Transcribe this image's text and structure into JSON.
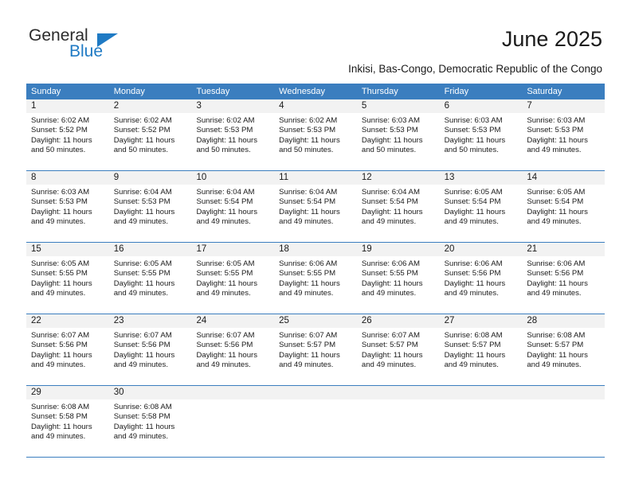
{
  "brand": {
    "name_part1": "General",
    "name_part2": "Blue",
    "logo_icon": "triangle-icon"
  },
  "header": {
    "title": "June 2025",
    "subtitle": "Inkisi, Bas-Congo, Democratic Republic of the Congo"
  },
  "colors": {
    "header_blue": "#3b7ebf",
    "brand_blue": "#1f7ac4",
    "daynum_band": "#f2f2f2",
    "text": "#1a1a1a"
  },
  "calendar": {
    "weekday_headers": [
      "Sunday",
      "Monday",
      "Tuesday",
      "Wednesday",
      "Thursday",
      "Friday",
      "Saturday"
    ],
    "weeks": [
      [
        {
          "day": "1",
          "sunrise": "Sunrise: 6:02 AM",
          "sunset": "Sunset: 5:52 PM",
          "daylight": "Daylight: 11 hours and 50 minutes."
        },
        {
          "day": "2",
          "sunrise": "Sunrise: 6:02 AM",
          "sunset": "Sunset: 5:52 PM",
          "daylight": "Daylight: 11 hours and 50 minutes."
        },
        {
          "day": "3",
          "sunrise": "Sunrise: 6:02 AM",
          "sunset": "Sunset: 5:53 PM",
          "daylight": "Daylight: 11 hours and 50 minutes."
        },
        {
          "day": "4",
          "sunrise": "Sunrise: 6:02 AM",
          "sunset": "Sunset: 5:53 PM",
          "daylight": "Daylight: 11 hours and 50 minutes."
        },
        {
          "day": "5",
          "sunrise": "Sunrise: 6:03 AM",
          "sunset": "Sunset: 5:53 PM",
          "daylight": "Daylight: 11 hours and 50 minutes."
        },
        {
          "day": "6",
          "sunrise": "Sunrise: 6:03 AM",
          "sunset": "Sunset: 5:53 PM",
          "daylight": "Daylight: 11 hours and 50 minutes."
        },
        {
          "day": "7",
          "sunrise": "Sunrise: 6:03 AM",
          "sunset": "Sunset: 5:53 PM",
          "daylight": "Daylight: 11 hours and 49 minutes."
        }
      ],
      [
        {
          "day": "8",
          "sunrise": "Sunrise: 6:03 AM",
          "sunset": "Sunset: 5:53 PM",
          "daylight": "Daylight: 11 hours and 49 minutes."
        },
        {
          "day": "9",
          "sunrise": "Sunrise: 6:04 AM",
          "sunset": "Sunset: 5:53 PM",
          "daylight": "Daylight: 11 hours and 49 minutes."
        },
        {
          "day": "10",
          "sunrise": "Sunrise: 6:04 AM",
          "sunset": "Sunset: 5:54 PM",
          "daylight": "Daylight: 11 hours and 49 minutes."
        },
        {
          "day": "11",
          "sunrise": "Sunrise: 6:04 AM",
          "sunset": "Sunset: 5:54 PM",
          "daylight": "Daylight: 11 hours and 49 minutes."
        },
        {
          "day": "12",
          "sunrise": "Sunrise: 6:04 AM",
          "sunset": "Sunset: 5:54 PM",
          "daylight": "Daylight: 11 hours and 49 minutes."
        },
        {
          "day": "13",
          "sunrise": "Sunrise: 6:05 AM",
          "sunset": "Sunset: 5:54 PM",
          "daylight": "Daylight: 11 hours and 49 minutes."
        },
        {
          "day": "14",
          "sunrise": "Sunrise: 6:05 AM",
          "sunset": "Sunset: 5:54 PM",
          "daylight": "Daylight: 11 hours and 49 minutes."
        }
      ],
      [
        {
          "day": "15",
          "sunrise": "Sunrise: 6:05 AM",
          "sunset": "Sunset: 5:55 PM",
          "daylight": "Daylight: 11 hours and 49 minutes."
        },
        {
          "day": "16",
          "sunrise": "Sunrise: 6:05 AM",
          "sunset": "Sunset: 5:55 PM",
          "daylight": "Daylight: 11 hours and 49 minutes."
        },
        {
          "day": "17",
          "sunrise": "Sunrise: 6:05 AM",
          "sunset": "Sunset: 5:55 PM",
          "daylight": "Daylight: 11 hours and 49 minutes."
        },
        {
          "day": "18",
          "sunrise": "Sunrise: 6:06 AM",
          "sunset": "Sunset: 5:55 PM",
          "daylight": "Daylight: 11 hours and 49 minutes."
        },
        {
          "day": "19",
          "sunrise": "Sunrise: 6:06 AM",
          "sunset": "Sunset: 5:55 PM",
          "daylight": "Daylight: 11 hours and 49 minutes."
        },
        {
          "day": "20",
          "sunrise": "Sunrise: 6:06 AM",
          "sunset": "Sunset: 5:56 PM",
          "daylight": "Daylight: 11 hours and 49 minutes."
        },
        {
          "day": "21",
          "sunrise": "Sunrise: 6:06 AM",
          "sunset": "Sunset: 5:56 PM",
          "daylight": "Daylight: 11 hours and 49 minutes."
        }
      ],
      [
        {
          "day": "22",
          "sunrise": "Sunrise: 6:07 AM",
          "sunset": "Sunset: 5:56 PM",
          "daylight": "Daylight: 11 hours and 49 minutes."
        },
        {
          "day": "23",
          "sunrise": "Sunrise: 6:07 AM",
          "sunset": "Sunset: 5:56 PM",
          "daylight": "Daylight: 11 hours and 49 minutes."
        },
        {
          "day": "24",
          "sunrise": "Sunrise: 6:07 AM",
          "sunset": "Sunset: 5:56 PM",
          "daylight": "Daylight: 11 hours and 49 minutes."
        },
        {
          "day": "25",
          "sunrise": "Sunrise: 6:07 AM",
          "sunset": "Sunset: 5:57 PM",
          "daylight": "Daylight: 11 hours and 49 minutes."
        },
        {
          "day": "26",
          "sunrise": "Sunrise: 6:07 AM",
          "sunset": "Sunset: 5:57 PM",
          "daylight": "Daylight: 11 hours and 49 minutes."
        },
        {
          "day": "27",
          "sunrise": "Sunrise: 6:08 AM",
          "sunset": "Sunset: 5:57 PM",
          "daylight": "Daylight: 11 hours and 49 minutes."
        },
        {
          "day": "28",
          "sunrise": "Sunrise: 6:08 AM",
          "sunset": "Sunset: 5:57 PM",
          "daylight": "Daylight: 11 hours and 49 minutes."
        }
      ],
      [
        {
          "day": "29",
          "sunrise": "Sunrise: 6:08 AM",
          "sunset": "Sunset: 5:58 PM",
          "daylight": "Daylight: 11 hours and 49 minutes."
        },
        {
          "day": "30",
          "sunrise": "Sunrise: 6:08 AM",
          "sunset": "Sunset: 5:58 PM",
          "daylight": "Daylight: 11 hours and 49 minutes."
        },
        {
          "day": "",
          "sunrise": "",
          "sunset": "",
          "daylight": ""
        },
        {
          "day": "",
          "sunrise": "",
          "sunset": "",
          "daylight": ""
        },
        {
          "day": "",
          "sunrise": "",
          "sunset": "",
          "daylight": ""
        },
        {
          "day": "",
          "sunrise": "",
          "sunset": "",
          "daylight": ""
        },
        {
          "day": "",
          "sunrise": "",
          "sunset": "",
          "daylight": ""
        }
      ]
    ]
  }
}
